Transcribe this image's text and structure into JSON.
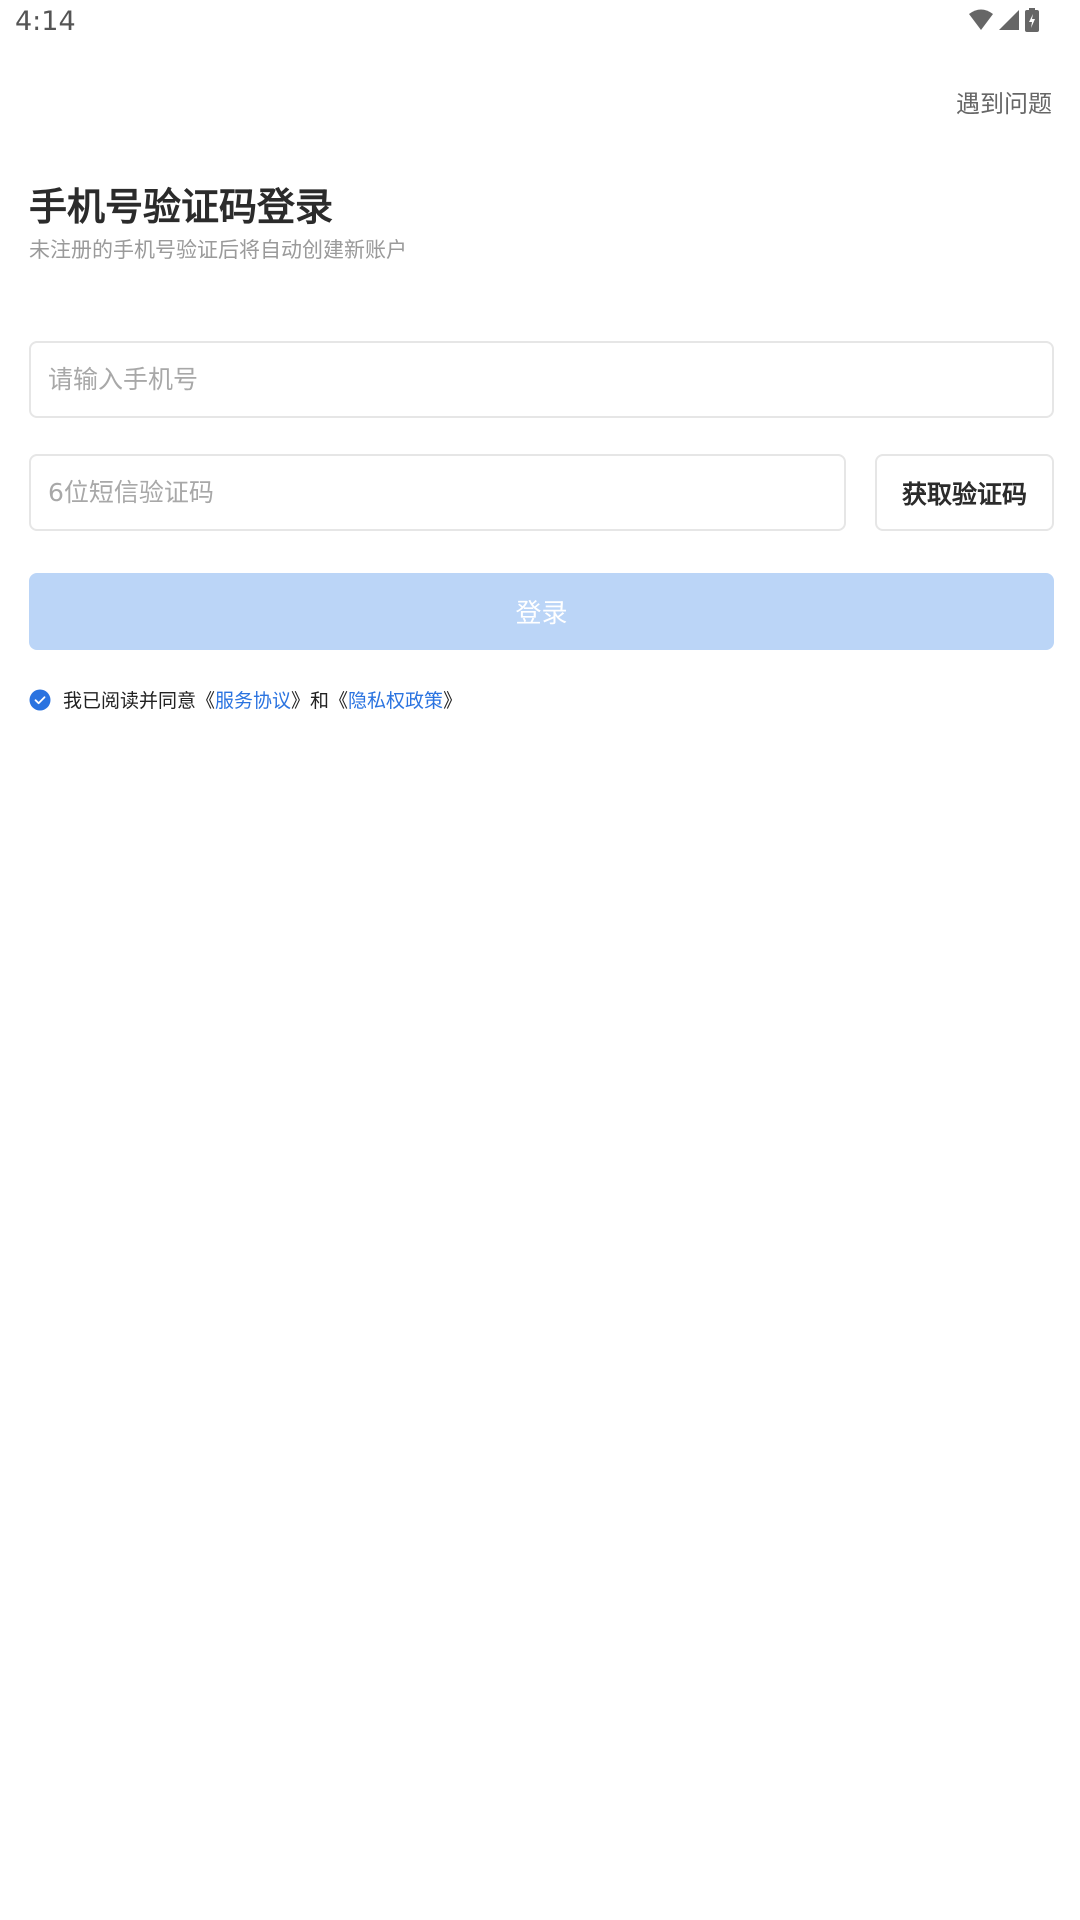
{
  "status_bar": {
    "time": "4:14",
    "icons": [
      "wifi-icon",
      "signal-icon",
      "battery-charging-icon"
    ]
  },
  "header": {
    "help_label": "遇到问题"
  },
  "main": {
    "title": "手机号验证码登录",
    "subtitle": "未注册的手机号验证后将自动创建新账户",
    "phone_input": {
      "value": "",
      "placeholder": "请输入手机号"
    },
    "code_input": {
      "value": "",
      "placeholder": "6位短信验证码"
    },
    "get_code_label": "获取验证码",
    "login_label": "登录"
  },
  "agreement": {
    "checked": true,
    "prefix": "我已阅读并同意《",
    "service_link": "服务协议",
    "middle": "》和《",
    "privacy_link": "隐私权政策",
    "suffix": "》"
  },
  "colors": {
    "accent": "#2a73e0",
    "login_disabled_bg": "#bbd5f7",
    "border": "#e6e6e6",
    "placeholder": "#a8a8a8"
  }
}
